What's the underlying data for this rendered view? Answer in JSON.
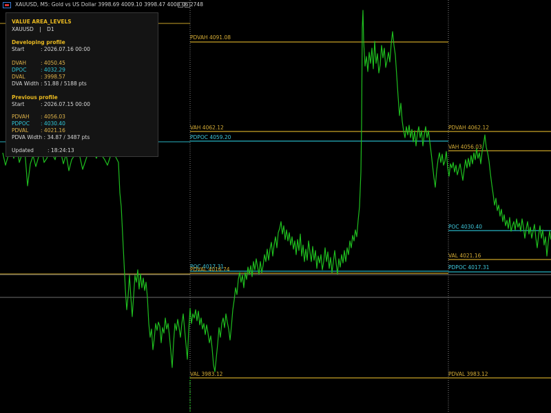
{
  "window": {
    "title": "XAUUSD, M5:  Gold vs US Dollar  3998.69 4009.10 3998.47 4008.06  2748"
  },
  "panel": {
    "title": "VALUE AREA_LEVELS",
    "symbol": "XAUUSD",
    "sep": "|",
    "timeframe": "D1",
    "developing": {
      "heading": "Developing profile",
      "start_label": "Start",
      "start_value": "2026.07.16 00:00",
      "dvah_label": "DVAH",
      "dvah_value": "4050.45",
      "dpoc_label": "DPOC",
      "dpoc_value": "4032.29",
      "dval_label": "DVAL",
      "dval_value": "3998.57",
      "width_label": "DVA Width",
      "width_value": "51.88 / 5188 pts"
    },
    "previous": {
      "heading": "Previous profile",
      "start_label": "Start",
      "start_value": "2026.07.15 00:00",
      "pdvah_label": "PDVAH",
      "pdvah_value": "4056.03",
      "pdpoc_label": "PDPOC",
      "pdpoc_value": "4030.40",
      "pdval_label": "PDVAL",
      "pdval_value": "4021.16",
      "width_label": "PDVA Width",
      "width_value": "34.87 / 3487 pts"
    },
    "updated_label": "Updated",
    "updated_value": "18:24:13",
    "colon": ":"
  },
  "levels": {
    "pdvah_4091": "PDVAH 4091.08",
    "vah_4062": "VAH 4062.12",
    "pdpoc_4059": "PDPOC 4059.20",
    "poc_4017": "POC 4017.31",
    "pdval_4016": "PDVAL 4016.74",
    "val_3983": "VAL 3983.12",
    "pdvah_4062": "PDVAH 4062.12",
    "vah_4056": "VAH 4056.03",
    "poc_4030": "POC 4030.40",
    "val_4021": "VAL 4021.16",
    "pdpoc_4017": "PDPOC 4017.31",
    "pdval_3983": "PDVAL 3983.12"
  },
  "colors": {
    "background": "#000000",
    "price": "#1fbf1f",
    "level_gold": "#c9a227",
    "level_aqua": "#27b3c4",
    "gridline": "#8a8a8a"
  }
}
